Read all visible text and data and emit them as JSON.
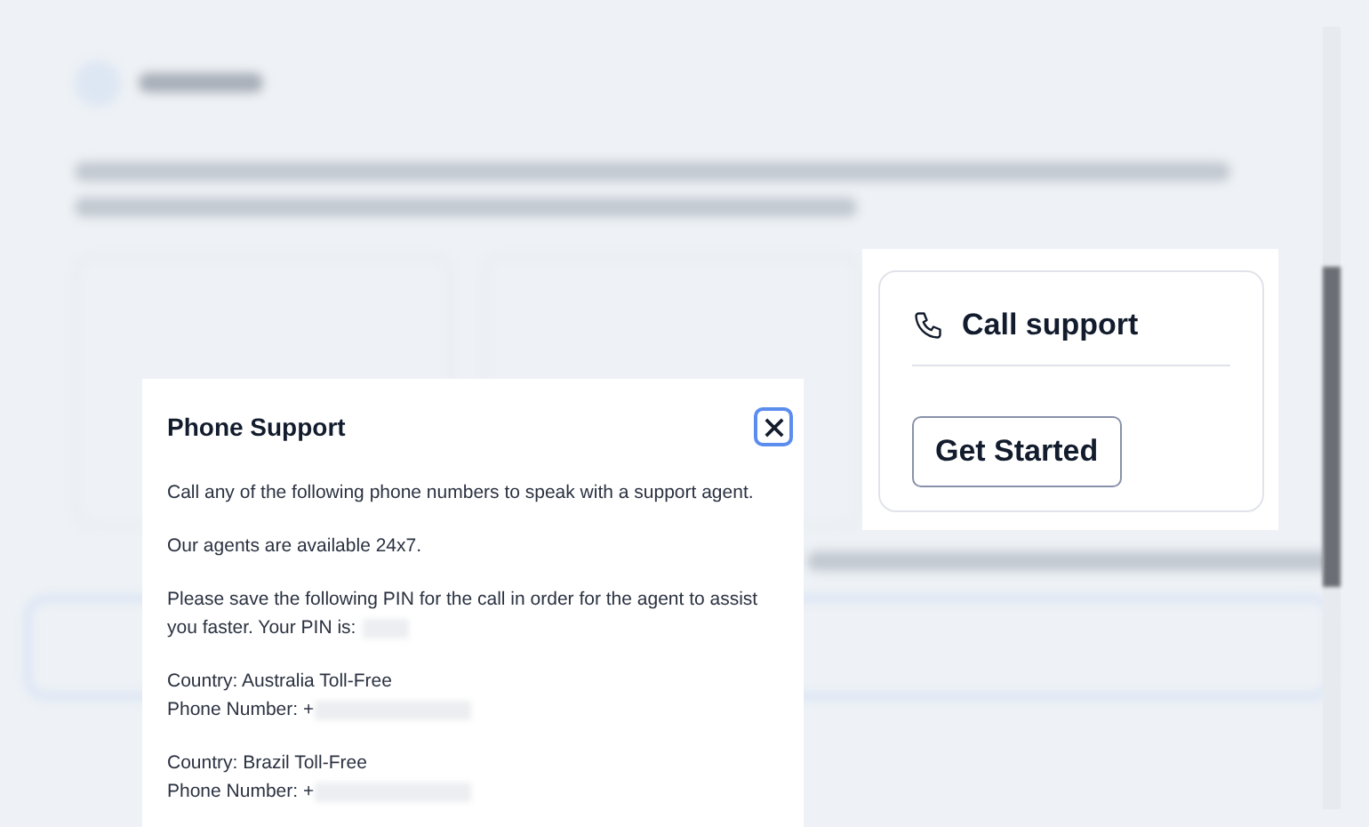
{
  "call_card": {
    "title": "Call support",
    "button": "Get Started"
  },
  "dialog": {
    "title": "Phone Support",
    "paragraphs": [
      "Call any of the following phone numbers to speak with a support agent.",
      "Our agents are available 24x7."
    ],
    "pin_lines": [
      "Please save the following PIN for the call in order for the agent to assist",
      "you faster. Your PIN is:"
    ],
    "countries": [
      {
        "country": "Country: Australia Toll-Free",
        "phone_label": "Phone Number: +"
      },
      {
        "country": "Country: Brazil Toll-Free",
        "phone_label": "Phone Number: +"
      }
    ]
  }
}
